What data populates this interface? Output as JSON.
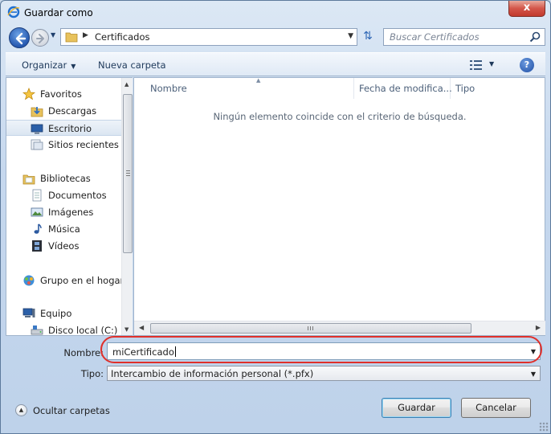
{
  "window": {
    "title": "Guardar como",
    "close_label": "x"
  },
  "nav": {
    "breadcrumb": "Certificados",
    "search_placeholder": "Buscar Certificados"
  },
  "toolbar": {
    "organize": "Organizar",
    "new_folder": "Nueva carpeta",
    "help": "?"
  },
  "sidebar": {
    "favorites": "Favoritos",
    "downloads": "Descargas",
    "desktop": "Escritorio",
    "recent": "Sitios recientes",
    "libraries": "Bibliotecas",
    "documents": "Documentos",
    "pictures": "Imágenes",
    "music": "Música",
    "videos": "Vídeos",
    "homegroup": "Grupo en el hogar",
    "computer": "Equipo",
    "local_disk": "Disco local (C:)"
  },
  "files": {
    "columns": [
      "Nombre",
      "Fecha de modifica...",
      "Tipo"
    ],
    "empty_message": "Ningún elemento coincide con el criterio de búsqueda."
  },
  "form": {
    "name_label": "Nombre:",
    "name_value": "miCertificado",
    "type_label": "Tipo:",
    "type_value": "Intercambio de información personal (*.pfx)"
  },
  "footer": {
    "hide_folders": "Ocultar carpetas",
    "save": "Guardar",
    "cancel": "Cancelar"
  },
  "colors": {
    "highlight_ring": "#e0302b",
    "selected_bg": "#dbe6f2",
    "accent": "#2659b0"
  }
}
